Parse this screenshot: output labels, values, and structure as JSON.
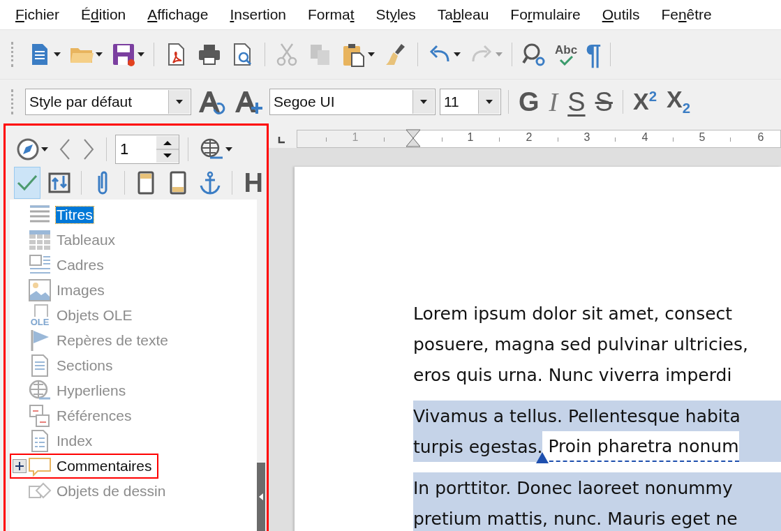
{
  "menu": [
    {
      "key": "F",
      "after": "ichier"
    },
    {
      "before": "É",
      "key": "d",
      "after": "ition"
    },
    {
      "key": "A",
      "after": "ffichage"
    },
    {
      "key": "I",
      "after": "nsertion"
    },
    {
      "before": "Forma",
      "key": "t"
    },
    {
      "before": "St",
      "key": "y",
      "after": "les"
    },
    {
      "before": "Ta",
      "key": "b",
      "after": "leau"
    },
    {
      "before": "Fo",
      "key": "r",
      "after": "mulaire"
    },
    {
      "key": "O",
      "after": "utils"
    },
    {
      "before": "Fe",
      "key": "n",
      "after": "être"
    }
  ],
  "toolbar": [
    [
      {
        "kind": "new",
        "has_menu": true,
        "disabled": false
      },
      {
        "kind": "open",
        "has_menu": true,
        "disabled": false
      },
      {
        "kind": "save",
        "has_menu": true,
        "disabled": false
      }
    ],
    [
      {
        "kind": "pdf",
        "has_menu": false,
        "disabled": false
      },
      {
        "kind": "print",
        "has_menu": false,
        "disabled": false
      },
      {
        "kind": "preview",
        "has_menu": false,
        "disabled": false
      }
    ],
    [
      {
        "kind": "cut",
        "has_menu": false,
        "disabled": true
      },
      {
        "kind": "copy",
        "has_menu": false,
        "disabled": true
      },
      {
        "kind": "paste",
        "has_menu": true,
        "disabled": false
      },
      {
        "kind": "brush",
        "has_menu": false,
        "disabled": false
      }
    ],
    [
      {
        "kind": "undo",
        "has_menu": true,
        "disabled": false
      },
      {
        "kind": "redo",
        "has_menu": true,
        "disabled": true
      }
    ],
    [
      {
        "kind": "find",
        "has_menu": false,
        "disabled": false
      },
      {
        "kind": "spell",
        "label": "Abc",
        "has_menu": false,
        "disabled": false
      },
      {
        "kind": "pilcrow",
        "label": "¶",
        "has_menu": false,
        "disabled": false
      }
    ]
  ],
  "format_bar": {
    "style": "Style par défaut",
    "font": "Segoe UI",
    "size": "11",
    "buttons": [
      {
        "kind": "bold",
        "label": "G"
      },
      {
        "kind": "italic",
        "label": "I"
      },
      {
        "kind": "underline",
        "label": "S"
      },
      {
        "kind": "strike",
        "label": "S"
      },
      {
        "kind": "superscript",
        "label": "X",
        "script": "2"
      },
      {
        "kind": "subscript",
        "label": "X",
        "script": "2"
      }
    ]
  },
  "navigator": {
    "page": "1",
    "buttons": [
      [
        {
          "kind": "content",
          "selected": true
        },
        {
          "kind": "promote",
          "selected": false
        }
      ],
      [
        {
          "kind": "clip",
          "selected": false
        }
      ],
      [
        {
          "kind": "header",
          "selected": false
        },
        {
          "kind": "footer",
          "selected": false
        },
        {
          "kind": "anchor",
          "selected": false
        }
      ],
      [
        {
          "kind": "heading",
          "label": "H",
          "selected": false
        }
      ]
    ],
    "items": [
      {
        "kind": "headings",
        "label": "Titres",
        "selected": true,
        "disabled": false,
        "collapsed": false,
        "outlined": false
      },
      {
        "kind": "tables",
        "label": "Tableaux",
        "selected": false,
        "disabled": true,
        "collapsed": false,
        "outlined": false
      },
      {
        "kind": "frames",
        "label": "Cadres",
        "selected": false,
        "disabled": true,
        "collapsed": false,
        "outlined": false
      },
      {
        "kind": "images",
        "label": "Images",
        "selected": false,
        "disabled": true,
        "collapsed": false,
        "outlined": false
      },
      {
        "kind": "ole",
        "label": "Objets OLE",
        "icon_text": "OLE",
        "selected": false,
        "disabled": true,
        "collapsed": false,
        "outlined": false
      },
      {
        "kind": "bookmarks",
        "label": "Repères de texte",
        "selected": false,
        "disabled": true,
        "collapsed": false,
        "outlined": false
      },
      {
        "kind": "sections",
        "label": "Sections",
        "selected": false,
        "disabled": true,
        "collapsed": false,
        "outlined": false
      },
      {
        "kind": "links",
        "label": "Hyperliens",
        "selected": false,
        "disabled": true,
        "collapsed": false,
        "outlined": false
      },
      {
        "kind": "references",
        "label": "Références",
        "selected": false,
        "disabled": true,
        "collapsed": false,
        "outlined": false
      },
      {
        "kind": "index",
        "label": "Index",
        "selected": false,
        "disabled": true,
        "collapsed": false,
        "outlined": false
      },
      {
        "kind": "comments",
        "label": "Commentaires",
        "selected": false,
        "disabled": false,
        "collapsed": true,
        "outlined": true
      },
      {
        "kind": "drawings",
        "label": "Objets de dessin",
        "selected": false,
        "disabled": true,
        "collapsed": false,
        "outlined": false
      }
    ]
  },
  "ruler": {
    "labels": [
      {
        "text": "1",
        "margin": true
      },
      {
        "text": "1",
        "margin": false
      },
      {
        "text": "2",
        "margin": false
      },
      {
        "text": "3",
        "margin": false
      },
      {
        "text": "4",
        "margin": false
      },
      {
        "text": "5",
        "margin": false
      },
      {
        "text": "6",
        "margin": false
      }
    ]
  },
  "document": {
    "paragraphs": [
      {
        "selected": false,
        "lines": [
          [
            {
              "text": "Lorem ipsum dolor sit amet, consect",
              "commented": false
            }
          ],
          [
            {
              "text": "posuere, magna sed pulvinar ultricies,",
              "commented": false
            }
          ],
          [
            {
              "text": "eros quis urna. Nunc viverra imperdi",
              "commented": false
            }
          ]
        ]
      },
      {
        "selected": true,
        "lines": [
          [
            {
              "text": "Vivamus a tellus. Pellentesque habita",
              "commented": false
            }
          ],
          [
            {
              "text": "turpis egestas.",
              "commented": false
            },
            {
              "text": " Proin pharetra nonum",
              "commented": true
            }
          ]
        ]
      },
      {
        "selected": true,
        "lines": [
          [
            {
              "text": "In porttitor. Donec laoreet nonummy",
              "commented": false
            }
          ],
          [
            {
              "text": "pretium mattis, nunc. Mauris eget ne",
              "commented": false
            }
          ]
        ]
      }
    ]
  }
}
